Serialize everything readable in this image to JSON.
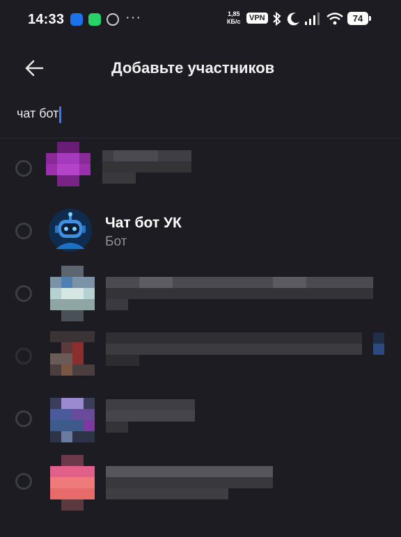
{
  "status_bar": {
    "time": "14:33",
    "speed_value": "1,85",
    "speed_unit": "КБ/с",
    "vpn": "VPN",
    "battery": "74",
    "icons": [
      "messages-icon",
      "whatsapp-icon",
      "app-icon",
      "more-icon",
      "bluetooth-icon",
      "moon-icon",
      "signal-icon",
      "wifi-icon",
      "battery-icon"
    ]
  },
  "header": {
    "back_icon": "arrow-left-icon",
    "title": "Добавьте участников"
  },
  "search": {
    "value": "чат бот"
  },
  "contacts": [
    {
      "id": 1,
      "name": "",
      "subtitle": "",
      "selected": false
    },
    {
      "id": 2,
      "name": "Чат бот УК",
      "subtitle": "Бот",
      "selected": false,
      "avatar": "robot-avatar"
    },
    {
      "id": 3,
      "name": "",
      "subtitle": "",
      "selected": false
    },
    {
      "id": 4,
      "name": "",
      "subtitle": "",
      "selected": false
    },
    {
      "id": 5,
      "name": "",
      "subtitle": "",
      "selected": false
    },
    {
      "id": 6,
      "name": "",
      "subtitle": "",
      "selected": false
    }
  ],
  "colors": {
    "background": "#1c1c22",
    "accent": "#2f7cf6",
    "radio_border": "#3d3d44",
    "subtitle": "#8e8e96"
  }
}
